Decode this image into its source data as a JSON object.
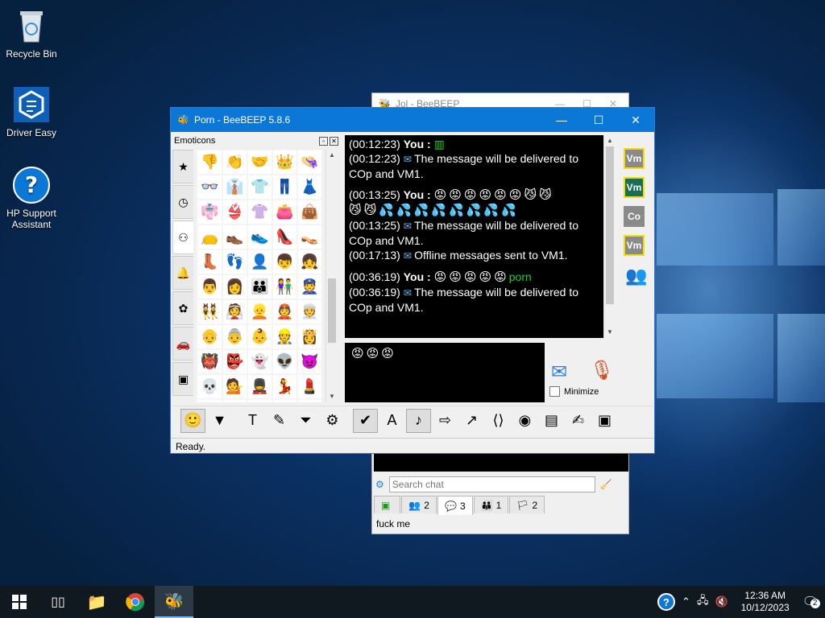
{
  "desktop": {
    "icons": [
      {
        "label": "Recycle Bin",
        "icon": "recycle-bin-icon"
      },
      {
        "label": "Driver Easy",
        "icon": "driver-easy-icon"
      },
      {
        "label": "HP Support\nAssistant",
        "icon": "hp-support-icon"
      }
    ]
  },
  "bg_window": {
    "title": "Jol - BeeBEEP",
    "search_placeholder": "Search chat",
    "tabs": [
      {
        "icon": "screen-icon",
        "count": ""
      },
      {
        "icon": "users-icon",
        "count": "2"
      },
      {
        "icon": "chat-icon",
        "count": "3"
      },
      {
        "icon": "groups-icon",
        "count": "1"
      },
      {
        "icon": "share-icon",
        "count": "2"
      }
    ],
    "status": "fuck me"
  },
  "window": {
    "title": "Porn - BeeBEEP 5.8.6",
    "emoticons_header": "Emoticons",
    "category_icons": [
      "star-icon",
      "clock-icon",
      "people-icon",
      "bell-icon",
      "flower-icon",
      "car-icon",
      "symbols-icon"
    ],
    "emoticons": [
      "👎",
      "👏",
      "🤝",
      "👑",
      "👒",
      "👓",
      "👔",
      "👕",
      "👖",
      "👗",
      "👘",
      "👙",
      "👚",
      "👛",
      "👜",
      "👝",
      "👞",
      "👟",
      "👠",
      "👡",
      "👢",
      "👣",
      "👤",
      "👦",
      "👧",
      "👨",
      "👩",
      "👪",
      "👫",
      "👮",
      "👯",
      "👰",
      "👱",
      "👲",
      "👳",
      "👴",
      "👵",
      "👶",
      "👷",
      "👸",
      "👹",
      "👺",
      "👻",
      "👽",
      "👿",
      "💀",
      "💁",
      "💂",
      "💃",
      "💄",
      "💅",
      "💆",
      "💇",
      "💋",
      "💌"
    ],
    "chat": [
      {
        "time": "(00:12:23)",
        "sender": "You",
        "suffix": ":",
        "emoji": "",
        "text": "",
        "green": "▥"
      },
      {
        "time": "(00:12:23)",
        "sender": "",
        "suffix": "",
        "emoji": "",
        "text": "The message will be delivered to",
        "mail": true
      },
      {
        "time": "",
        "sender": "",
        "suffix": "",
        "emoji": "",
        "text": "COp and VM1."
      },
      {
        "gap": true
      },
      {
        "time": "(00:13:25)",
        "sender": "You",
        "suffix": ":",
        "emoji": "😡😡😡😡😡😡😼😼",
        "text": ""
      },
      {
        "time": "",
        "sender": "",
        "suffix": "",
        "emoji": "😼😼💦💦💦💦💦💦💦💦",
        "text": ""
      },
      {
        "time": "(00:13:25)",
        "sender": "",
        "suffix": "",
        "emoji": "",
        "text": "The message will be delivered to",
        "mail": true
      },
      {
        "time": "",
        "sender": "",
        "suffix": "",
        "emoji": "",
        "text": "COp and VM1."
      },
      {
        "time": "(00:17:13)",
        "sender": "",
        "suffix": "",
        "emoji": "",
        "text": "Offline messages sent to VM1.",
        "mail": true
      },
      {
        "gap": true
      },
      {
        "time": "(00:36:19)",
        "sender": "You",
        "suffix": ":",
        "emoji": "😡😡😡😡😡",
        "text": "",
        "green": "porn"
      },
      {
        "time": "(00:36:19)",
        "sender": "",
        "suffix": "",
        "emoji": "",
        "text": "The message will be delivered to",
        "mail": true
      },
      {
        "time": "",
        "sender": "",
        "suffix": "",
        "emoji": "",
        "text": "COp and VM1."
      }
    ],
    "input_text": "😡😡😡",
    "minimize_label": "Minimize",
    "users": [
      {
        "label": "Vm",
        "color": "#8a8a8a",
        "border": "#f0e000"
      },
      {
        "label": "Vm",
        "color": "#1a6e55",
        "border": "#f0e000"
      },
      {
        "label": "Co",
        "color": "#8a8a8a",
        "border": "#8a8a8a"
      },
      {
        "label": "Vm",
        "color": "#8a8a8a",
        "border": "#f0e000"
      }
    ],
    "toolbar": [
      {
        "icon": "smiley-icon",
        "glyph": "🙂",
        "pressed": true
      },
      {
        "icon": "color-icon",
        "glyph": "▼",
        "pressed": false
      },
      {
        "icon": "font-icon",
        "glyph": "T",
        "pressed": false
      },
      {
        "icon": "pen-icon",
        "glyph": "✎",
        "pressed": false
      },
      {
        "icon": "filter-icon",
        "glyph": "⏷",
        "pressed": false
      },
      {
        "icon": "settings-icon",
        "glyph": "⚙",
        "pressed": false
      },
      {
        "icon": "spellcheck-icon",
        "glyph": "✔",
        "pressed": true
      },
      {
        "icon": "font-size-icon",
        "glyph": "A",
        "pressed": false
      },
      {
        "icon": "note-icon",
        "glyph": "♪",
        "pressed": true
      },
      {
        "icon": "save-icon",
        "glyph": "⇨",
        "pressed": false
      },
      {
        "icon": "folder-send-icon",
        "glyph": "↗",
        "pressed": false
      },
      {
        "icon": "code-icon",
        "glyph": "⟨⟩",
        "pressed": false
      },
      {
        "icon": "camera-icon",
        "glyph": "◉",
        "pressed": false
      },
      {
        "icon": "shelf-icon",
        "glyph": "▤",
        "pressed": false
      },
      {
        "icon": "edit-icon",
        "glyph": "✍",
        "pressed": false
      },
      {
        "icon": "disk-icon",
        "glyph": "▣",
        "pressed": false
      }
    ],
    "status": "Ready."
  },
  "taskbar": {
    "time": "12:36 AM",
    "date": "10/12/2023",
    "notification_count": "2"
  }
}
